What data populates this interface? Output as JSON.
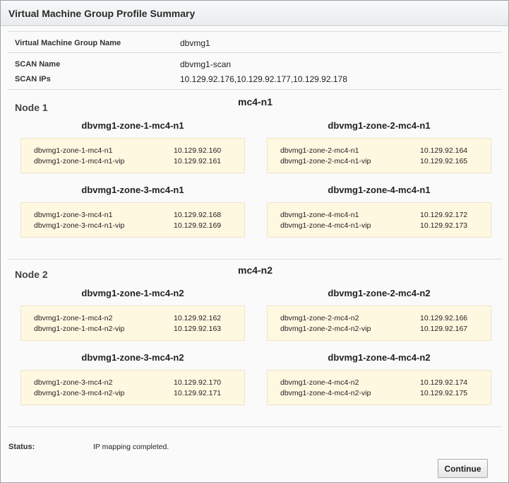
{
  "dialog": {
    "title": "Virtual Machine Group Profile Summary"
  },
  "summary": {
    "group_name_label": "Virtual Machine Group Name",
    "group_name_value": "dbvmg1",
    "scan_name_label": "SCAN Name",
    "scan_name_value": "dbvmg1-scan",
    "scan_ips_label": "SCAN IPs",
    "scan_ips_value": "10.129.92.176,10.129.92.177,10.129.92.178"
  },
  "nodes": [
    {
      "label": "Node 1",
      "host": "mc4-n1",
      "zones": [
        {
          "title": "dbvmg1-zone-1-mc4-n1",
          "rows": [
            {
              "name": "dbvmg1-zone-1-mc4-n1",
              "ip": "10.129.92.160"
            },
            {
              "name": "dbvmg1-zone-1-mc4-n1-vip",
              "ip": "10.129.92.161"
            }
          ]
        },
        {
          "title": "dbvmg1-zone-2-mc4-n1",
          "rows": [
            {
              "name": "dbvmg1-zone-2-mc4-n1",
              "ip": "10.129.92.164"
            },
            {
              "name": "dbvmg1-zone-2-mc4-n1-vip",
              "ip": "10.129.92.165"
            }
          ]
        },
        {
          "title": "dbvmg1-zone-3-mc4-n1",
          "rows": [
            {
              "name": "dbvmg1-zone-3-mc4-n1",
              "ip": "10.129.92.168"
            },
            {
              "name": "dbvmg1-zone-3-mc4-n1-vip",
              "ip": "10.129.92.169"
            }
          ]
        },
        {
          "title": "dbvmg1-zone-4-mc4-n1",
          "rows": [
            {
              "name": "dbvmg1-zone-4-mc4-n1",
              "ip": "10.129.92.172"
            },
            {
              "name": "dbvmg1-zone-4-mc4-n1-vip",
              "ip": "10.129.92.173"
            }
          ]
        }
      ]
    },
    {
      "label": "Node 2",
      "host": "mc4-n2",
      "zones": [
        {
          "title": "dbvmg1-zone-1-mc4-n2",
          "rows": [
            {
              "name": "dbvmg1-zone-1-mc4-n2",
              "ip": "10.129.92.162"
            },
            {
              "name": "dbvmg1-zone-1-mc4-n2-vip",
              "ip": "10.129.92.163"
            }
          ]
        },
        {
          "title": "dbvmg1-zone-2-mc4-n2",
          "rows": [
            {
              "name": "dbvmg1-zone-2-mc4-n2",
              "ip": "10.129.92.166"
            },
            {
              "name": "dbvmg1-zone-2-mc4-n2-vip",
              "ip": "10.129.92.167"
            }
          ]
        },
        {
          "title": "dbvmg1-zone-3-mc4-n2",
          "rows": [
            {
              "name": "dbvmg1-zone-3-mc4-n2",
              "ip": "10.129.92.170"
            },
            {
              "name": "dbvmg1-zone-3-mc4-n2-vip",
              "ip": "10.129.92.171"
            }
          ]
        },
        {
          "title": "dbvmg1-zone-4-mc4-n2",
          "rows": [
            {
              "name": "dbvmg1-zone-4-mc4-n2",
              "ip": "10.129.92.174"
            },
            {
              "name": "dbvmg1-zone-4-mc4-n2-vip",
              "ip": "10.129.92.175"
            }
          ]
        }
      ]
    }
  ],
  "status": {
    "label": "Status:",
    "value": "IP mapping completed."
  },
  "actions": {
    "continue_label": "Continue"
  },
  "colors": {
    "zone_box_background": "#fff8e1",
    "title_bar": "#eceff1"
  }
}
